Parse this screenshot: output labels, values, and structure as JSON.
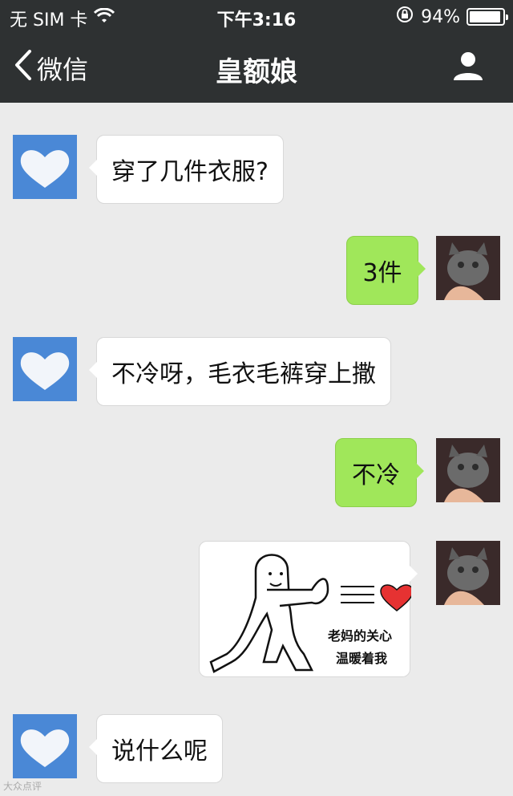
{
  "status_bar": {
    "carrier": "无 SIM 卡",
    "time": "下午3:16",
    "battery": "94%",
    "battery_level": 0.94
  },
  "nav": {
    "back_label": "微信",
    "title": "皇额娘"
  },
  "messages": [
    {
      "side": "in",
      "text": "穿了几件衣服?"
    },
    {
      "side": "out",
      "text": "3件"
    },
    {
      "side": "in",
      "text": "不冷呀，毛衣毛裤穿上撒"
    },
    {
      "side": "out",
      "text": "不冷"
    },
    {
      "side": "out",
      "type": "sticker",
      "caption_line1": "老妈的关心",
      "caption_line2": "温暖着我"
    },
    {
      "side": "in",
      "text": "说什么呢"
    }
  ],
  "watermark": "大众点评"
}
